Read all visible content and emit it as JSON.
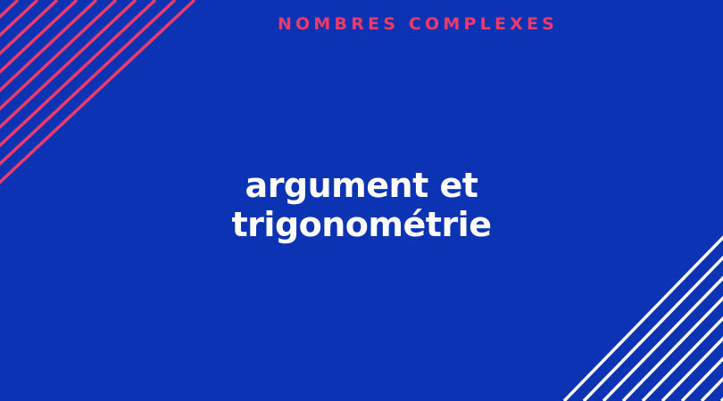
{
  "header": {
    "kicker": "NOMBRES COMPLEXES"
  },
  "title": {
    "line1": "argument et",
    "line2": "trigonométrie"
  },
  "colors": {
    "background": "#0c33b4",
    "accent": "#ee3a6a",
    "text": "#ffffff",
    "left_stripes": "#ee3a6a",
    "right_stripes": "#ffffff"
  }
}
